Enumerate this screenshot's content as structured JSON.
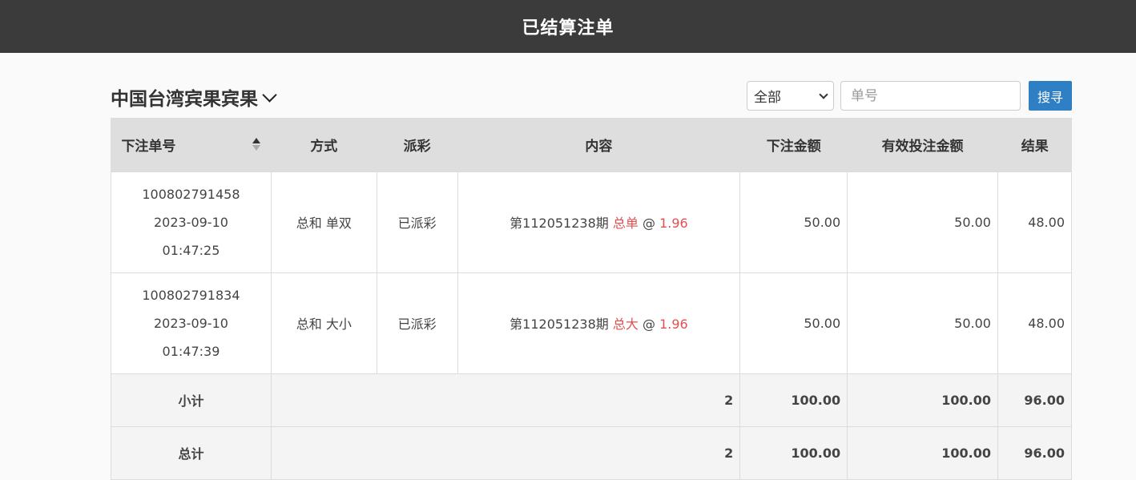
{
  "header": {
    "title": "已结算注单"
  },
  "toolbar": {
    "lottery_name": "中国台湾宾果宾果",
    "filter_selected": "全部",
    "search_placeholder": "单号",
    "search_label": "搜寻"
  },
  "table": {
    "columns": [
      "下注单号",
      "方式",
      "派彩",
      "内容",
      "下注金额",
      "有效投注金额",
      "结果"
    ],
    "rows": [
      {
        "order_no": "100802791458",
        "date": "2023-09-10",
        "time": "01:47:25",
        "method": "总和 单双",
        "payout": "已派彩",
        "period": "第112051238期",
        "pick": "总单",
        "at": "@",
        "odds": "1.96",
        "bet_amount": "50.00",
        "valid_amount": "50.00",
        "result": "48.00"
      },
      {
        "order_no": "100802791834",
        "date": "2023-09-10",
        "time": "01:47:39",
        "method": "总和 大小",
        "payout": "已派彩",
        "period": "第112051238期",
        "pick": "总大",
        "at": "@",
        "odds": "1.96",
        "bet_amount": "50.00",
        "valid_amount": "50.00",
        "result": "48.00"
      }
    ],
    "subtotal": {
      "label": "小计",
      "count": "2",
      "bet_amount": "100.00",
      "valid_amount": "100.00",
      "result": "96.00"
    },
    "total": {
      "label": "总计",
      "count": "2",
      "bet_amount": "100.00",
      "valid_amount": "100.00",
      "result": "96.00"
    }
  },
  "colors": {
    "topbar": "#3b3b3b",
    "button": "#2f7fc4",
    "highlight": "#e05050"
  }
}
